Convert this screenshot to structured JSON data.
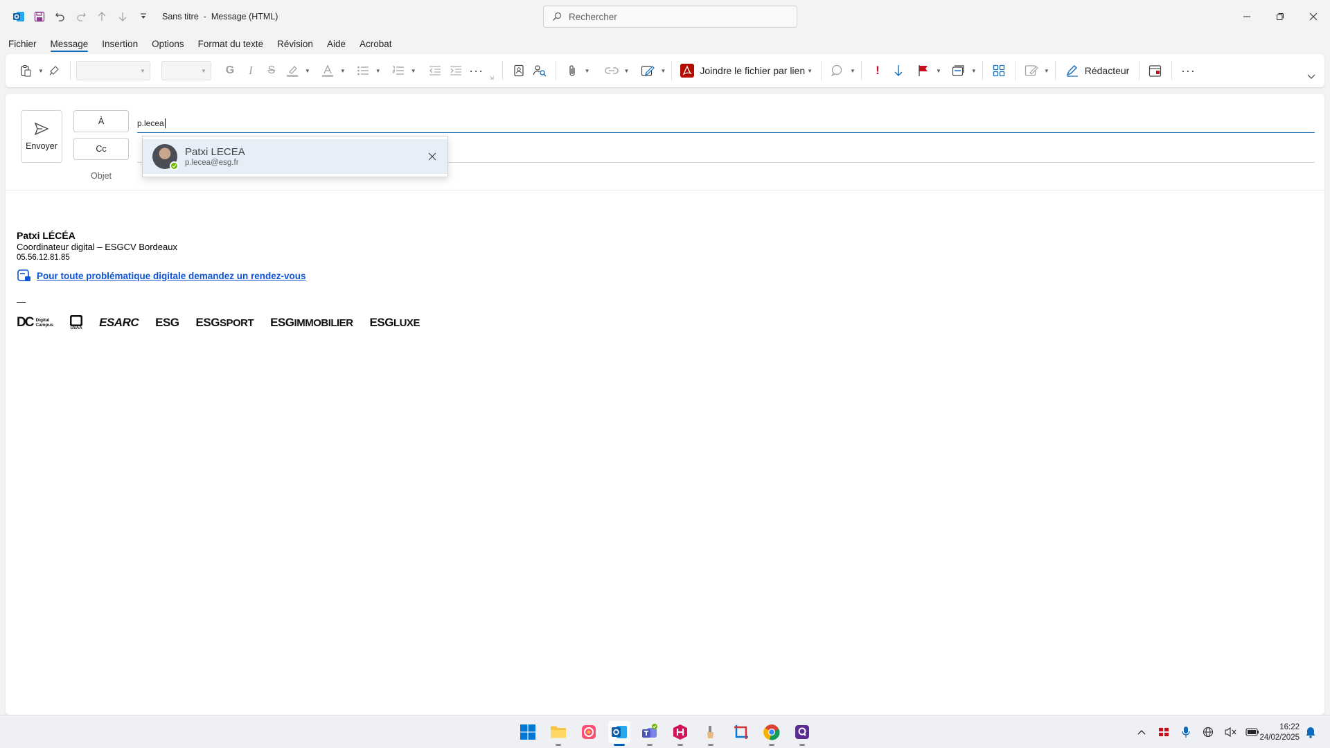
{
  "window": {
    "doc_title": "Sans titre",
    "separator": "-",
    "doc_type": "Message (HTML)",
    "search_placeholder": "Rechercher"
  },
  "menu": {
    "tabs": [
      "Fichier",
      "Message",
      "Insertion",
      "Options",
      "Format du texte",
      "Révision",
      "Aide",
      "Acrobat"
    ],
    "active_tab": "Message"
  },
  "ribbon": {
    "attach_link_label": "Joindre le fichier par lien",
    "editor_label": "Rédacteur"
  },
  "compose": {
    "send_label": "Envoyer",
    "to_label": "À",
    "cc_label": "Cc",
    "subject_label": "Objet",
    "to_value": "p.lecea"
  },
  "suggestion": {
    "name": "Patxi LECEA",
    "email": "p.lecea@esg.fr",
    "presence": "available"
  },
  "signature": {
    "name": "Patxi LÉCÉA",
    "role": "Coordinateur digital – ESGCV Bordeaux",
    "phone": "05.56.12.81.85",
    "link_text": "Pour toute problématique digitale demandez un rendez-vous",
    "dash": "—",
    "logos": {
      "dc_mark": "DC",
      "dc_line1": "Digital",
      "dc_line2": "Campus",
      "usaa": "USAA",
      "esarc": "ESARC",
      "esg": "ESG",
      "esg_sport_prefix": "ESG",
      "esg_sport_suffix": "SPORT",
      "esg_immo_prefix": "ESG",
      "esg_immo_suffix": "IMMOBILIER",
      "esg_luxe_prefix": "ESG",
      "esg_luxe_suffix": "LUXE"
    }
  },
  "taskbar": {
    "time": "16:22",
    "date": "24/02/2025"
  },
  "colors": {
    "accent": "#0f6cbd",
    "link": "#0b52d6",
    "presence": "#6bb700",
    "flag": "#c50f1f"
  }
}
